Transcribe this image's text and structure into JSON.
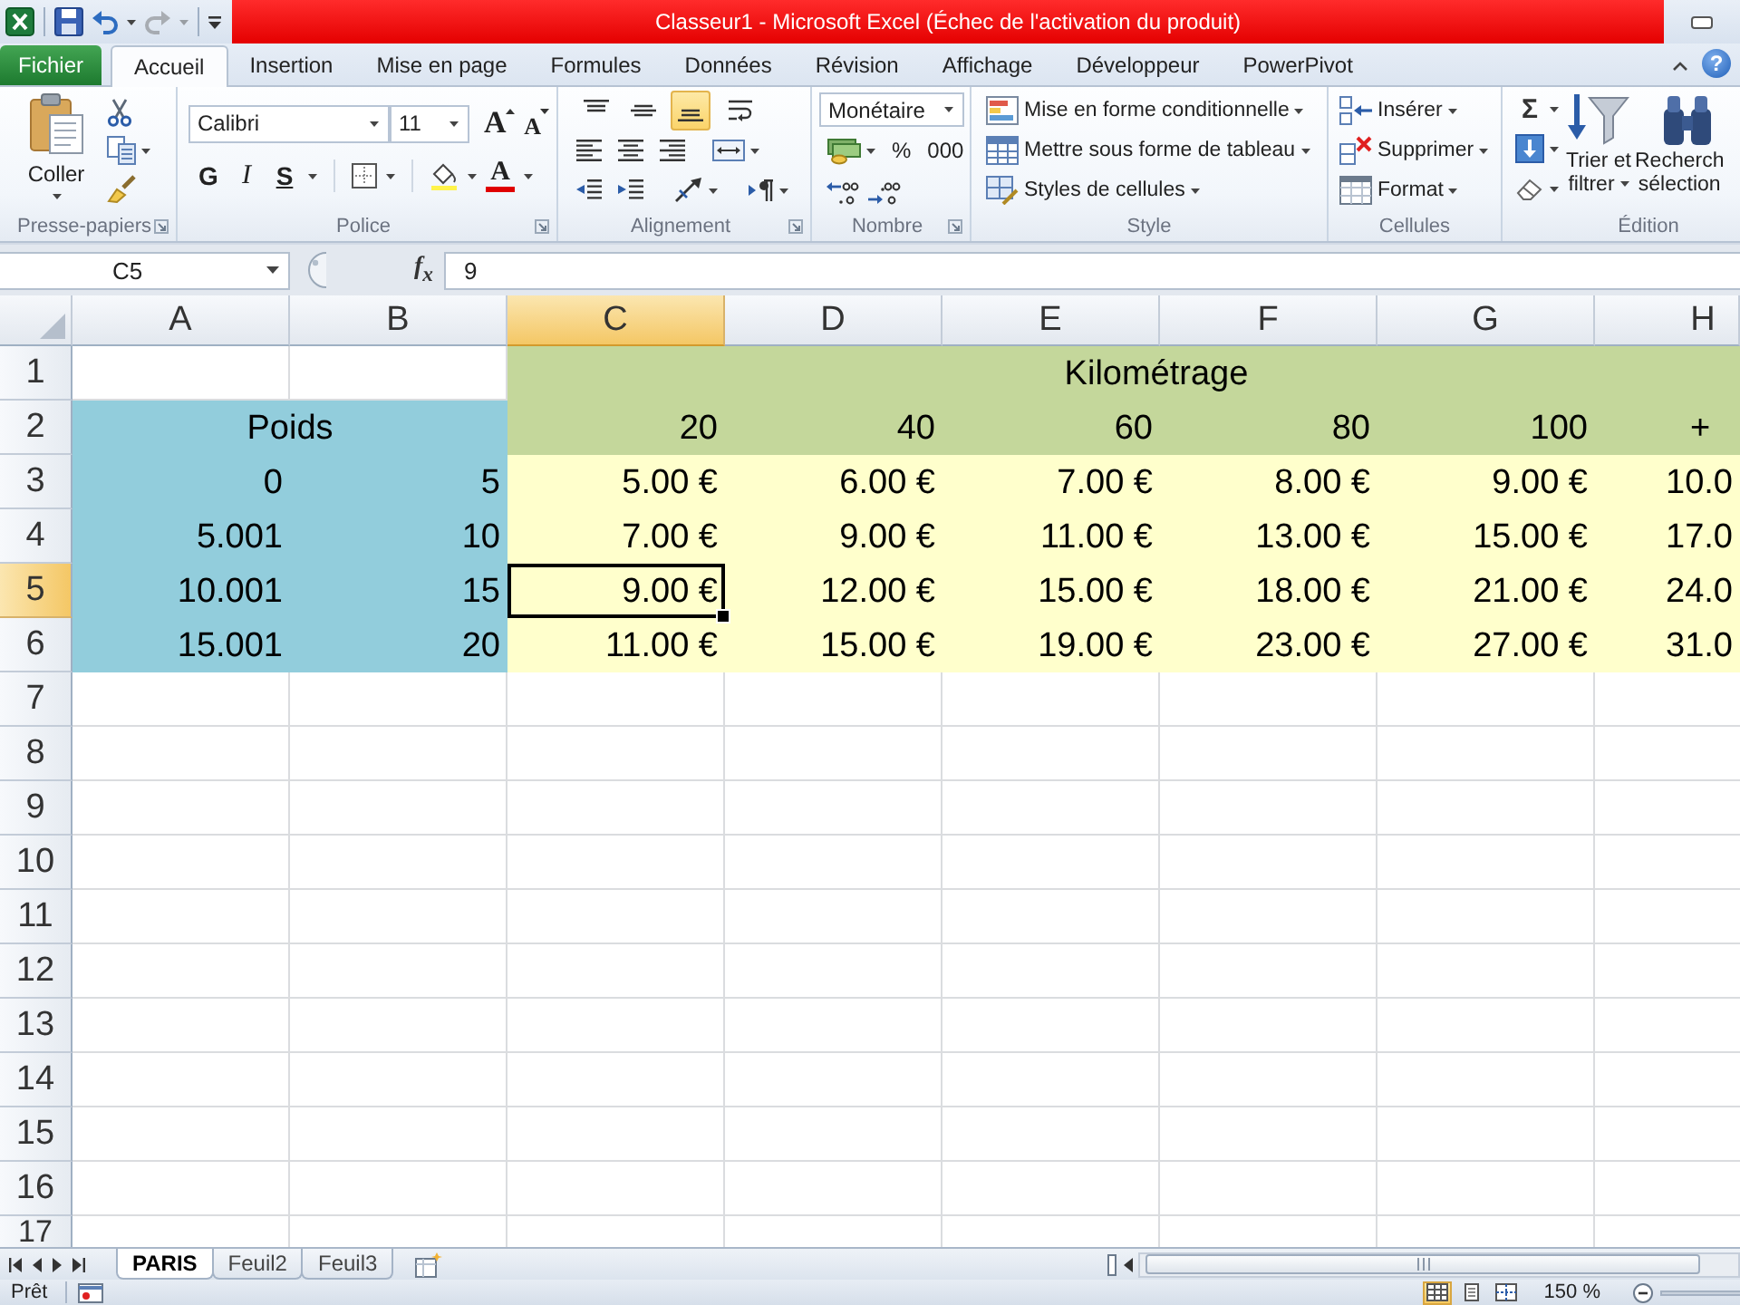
{
  "window": {
    "title": "Classeur1 - Microsoft Excel (Échec de l'activation du produit)"
  },
  "quick_access": [
    {
      "kind": "save",
      "disabled": false
    },
    {
      "kind": "undo",
      "disabled": false
    },
    {
      "kind": "redo",
      "disabled": true
    }
  ],
  "ribbon_tabs": [
    {
      "label": "Fichier",
      "kind": "file",
      "selected": false
    },
    {
      "label": "Accueil",
      "kind": "tab",
      "selected": true
    },
    {
      "label": "Insertion",
      "kind": "tab",
      "selected": false
    },
    {
      "label": "Mise en page",
      "kind": "tab",
      "selected": false
    },
    {
      "label": "Formules",
      "kind": "tab",
      "selected": false
    },
    {
      "label": "Données",
      "kind": "tab",
      "selected": false
    },
    {
      "label": "Révision",
      "kind": "tab",
      "selected": false
    },
    {
      "label": "Affichage",
      "kind": "tab",
      "selected": false
    },
    {
      "label": "Développeur",
      "kind": "tab",
      "selected": false
    },
    {
      "label": "PowerPivot",
      "kind": "tab",
      "selected": false
    }
  ],
  "help": "?",
  "clipboard": {
    "title": "Presse-papiers",
    "paste": "Coller"
  },
  "font": {
    "title": "Police",
    "name": "Calibri",
    "size": "11",
    "grow": "A",
    "shrink": "A",
    "bold": "G",
    "italic": "I",
    "underline": "S",
    "font_color_label": "A"
  },
  "alignment": {
    "title": "Alignement",
    "vertical": [
      {
        "kind": "top",
        "selected": false
      },
      {
        "kind": "middle",
        "selected": false
      },
      {
        "kind": "bottom",
        "selected": true
      }
    ]
  },
  "number": {
    "title": "Nombre",
    "format": "Monétaire",
    "percent": "%",
    "thousands": "000"
  },
  "style": {
    "title": "Style",
    "items": [
      {
        "kind": "conditional",
        "label": "Mise en forme conditionnelle"
      },
      {
        "kind": "table",
        "label": "Mettre sous forme de tableau"
      },
      {
        "kind": "cell_styles",
        "label": "Styles de cellules"
      }
    ]
  },
  "cells": {
    "title": "Cellules",
    "items": [
      {
        "kind": "insert",
        "label": "Insérer"
      },
      {
        "kind": "delete",
        "label": "Supprimer"
      },
      {
        "kind": "format",
        "label": "Format"
      }
    ]
  },
  "editing": {
    "title": "Édition",
    "sum": "Σ",
    "sort": [
      "Trier et",
      "filtrer"
    ],
    "find": [
      "Recherch",
      "sélection"
    ]
  },
  "formula_bar": {
    "name_box": "C5",
    "function_label": "f$_{x}$",
    "value": "9"
  },
  "sheet": {
    "columns": [
      {
        "label": "A",
        "selected": false
      },
      {
        "label": "B",
        "selected": false
      },
      {
        "label": "C",
        "selected": true
      },
      {
        "label": "D",
        "selected": false
      },
      {
        "label": "E",
        "selected": false
      },
      {
        "label": "F",
        "selected": false
      },
      {
        "label": "G",
        "selected": false
      },
      {
        "label": "H",
        "selected": false
      }
    ],
    "rows": [
      {
        "label": "1",
        "selected": false,
        "cells": [
          {
            "kind": "empty"
          },
          {
            "kind": "empty"
          },
          {
            "kind": "centered",
            "text": "Kilométrage",
            "color": "#c4d79b"
          },
          {
            "kind": "merged"
          },
          {
            "kind": "merged"
          },
          {
            "kind": "merged"
          },
          {
            "kind": "merged"
          },
          {
            "kind": "merged"
          }
        ]
      },
      {
        "label": "2",
        "selected": false,
        "cells": [
          {
            "kind": "centered",
            "text": "Poids",
            "color": "#92cddc"
          },
          {
            "kind": "merged"
          },
          {
            "kind": "number",
            "text": "20",
            "color": "#c4d79b"
          },
          {
            "kind": "number",
            "text": "40",
            "color": "#c4d79b"
          },
          {
            "kind": "number",
            "text": "60",
            "color": "#c4d79b"
          },
          {
            "kind": "number",
            "text": "80",
            "color": "#c4d79b"
          },
          {
            "kind": "number",
            "text": "100",
            "color": "#c4d79b"
          },
          {
            "kind": "centered",
            "text": "+",
            "color": "#c4d79b"
          }
        ]
      },
      {
        "label": "3",
        "selected": false,
        "cells": [
          {
            "kind": "number",
            "text": "0",
            "color": "#92cddc"
          },
          {
            "kind": "number",
            "text": "5",
            "color": "#92cddc"
          },
          {
            "kind": "number",
            "text": "5.00 €",
            "color": "#ffffcc"
          },
          {
            "kind": "number",
            "text": "6.00 €",
            "color": "#ffffcc"
          },
          {
            "kind": "number",
            "text": "7.00 €",
            "color": "#ffffcc"
          },
          {
            "kind": "number",
            "text": "8.00 €",
            "color": "#ffffcc"
          },
          {
            "kind": "number",
            "text": "9.00 €",
            "color": "#ffffcc"
          },
          {
            "kind": "number",
            "text": "10.0",
            "color": "#ffffcc"
          }
        ]
      },
      {
        "label": "4",
        "selected": false,
        "cells": [
          {
            "kind": "number",
            "text": "5.001",
            "color": "#92cddc"
          },
          {
            "kind": "number",
            "text": "10",
            "color": "#92cddc"
          },
          {
            "kind": "number",
            "text": "7.00 €",
            "color": "#ffffcc"
          },
          {
            "kind": "number",
            "text": "9.00 €",
            "color": "#ffffcc"
          },
          {
            "kind": "number",
            "text": "11.00 €",
            "color": "#ffffcc"
          },
          {
            "kind": "number",
            "text": "13.00 €",
            "color": "#ffffcc"
          },
          {
            "kind": "number",
            "text": "15.00 €",
            "color": "#ffffcc"
          },
          {
            "kind": "number",
            "text": "17.0",
            "color": "#ffffcc"
          }
        ]
      },
      {
        "label": "5",
        "selected": true,
        "cells": [
          {
            "kind": "number",
            "text": "10.001",
            "color": "#92cddc"
          },
          {
            "kind": "number",
            "text": "15",
            "color": "#92cddc"
          },
          {
            "kind": "number",
            "text": "9.00 €",
            "color": "#ffffcc"
          },
          {
            "kind": "number",
            "text": "12.00 €",
            "color": "#ffffcc"
          },
          {
            "kind": "number",
            "text": "15.00 €",
            "color": "#ffffcc"
          },
          {
            "kind": "number",
            "text": "18.00 €",
            "color": "#ffffcc"
          },
          {
            "kind": "number",
            "text": "21.00 €",
            "color": "#ffffcc"
          },
          {
            "kind": "number",
            "text": "24.0",
            "color": "#ffffcc"
          }
        ]
      },
      {
        "label": "6",
        "selected": false,
        "cells": [
          {
            "kind": "number",
            "text": "15.001",
            "color": "#92cddc"
          },
          {
            "kind": "number",
            "text": "20",
            "color": "#92cddc"
          },
          {
            "kind": "number",
            "text": "11.00 €",
            "color": "#ffffcc"
          },
          {
            "kind": "number",
            "text": "15.00 €",
            "color": "#ffffcc"
          },
          {
            "kind": "number",
            "text": "19.00 €",
            "color": "#ffffcc"
          },
          {
            "kind": "number",
            "text": "23.00 €",
            "color": "#ffffcc"
          },
          {
            "kind": "number",
            "text": "27.00 €",
            "color": "#ffffcc"
          },
          {
            "kind": "number",
            "text": "31.0",
            "color": "#ffffcc"
          }
        ]
      },
      {
        "label": "7",
        "selected": false
      },
      {
        "label": "8",
        "selected": false
      },
      {
        "label": "9",
        "selected": false
      },
      {
        "label": "10",
        "selected": false
      },
      {
        "label": "11",
        "selected": false
      },
      {
        "label": "12",
        "selected": false
      },
      {
        "label": "13",
        "selected": false
      },
      {
        "label": "14",
        "selected": false
      },
      {
        "label": "15",
        "selected": false
      },
      {
        "label": "16",
        "selected": false
      },
      {
        "label": "17",
        "selected": false
      }
    ]
  },
  "sheet_tabs": [
    {
      "label": "PARIS",
      "selected": true
    },
    {
      "label": "Feuil2",
      "selected": false
    },
    {
      "label": "Feuil3",
      "selected": false
    }
  ],
  "status_bar": {
    "status": "Prêt",
    "views": [
      {
        "kind": "normal",
        "selected": true
      },
      {
        "kind": "page_layout",
        "selected": false
      },
      {
        "kind": "page_break",
        "selected": false
      }
    ],
    "zoom": "150 %"
  }
}
